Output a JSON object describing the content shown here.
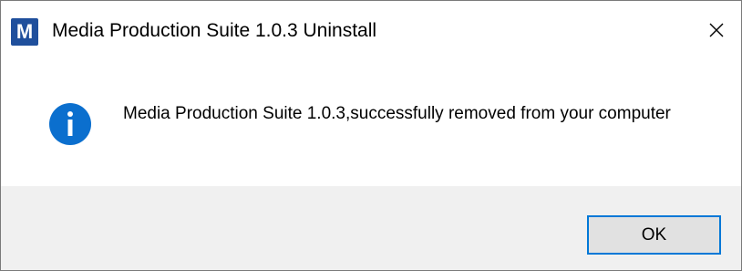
{
  "window": {
    "title": "Media Production Suite 1.0.3 Uninstall",
    "app_icon_letter": "M",
    "app_icon_color": "#1f4f9c",
    "close_icon": "close-icon"
  },
  "dialog": {
    "icon": "info-icon",
    "icon_color": "#0b6fce",
    "message": "Media Production Suite 1.0.3,successfully removed from your computer"
  },
  "buttons": {
    "ok_label": "OK",
    "ok_border_color": "#0078d7"
  }
}
